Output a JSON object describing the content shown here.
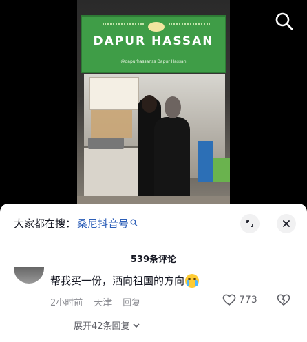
{
  "video": {
    "sign_title": "DAPUR HASSAN",
    "sign_social": "@dapurhassanss  Dapur Hassan"
  },
  "sheet": {
    "hot_prefix": "大家都在搜：",
    "hot_query": "桑尼抖音号",
    "comment_count": "539条评论"
  },
  "comment": {
    "text": "帮我买一份，洒向祖国的方向",
    "time": "2小时前",
    "location": "天津",
    "reply_label": "回复",
    "likes": "773",
    "expand_label": "展开42条回复"
  },
  "icons": {
    "search": "search-icon",
    "expand": "expand-icon",
    "close": "close-icon",
    "like": "heart-icon",
    "dislike": "dislike-heart-icon",
    "chevron": "chevron-down-icon"
  },
  "colors": {
    "link": "#2d5fb8",
    "muted": "#8a8b91",
    "sign_green": "#3f9d47"
  }
}
